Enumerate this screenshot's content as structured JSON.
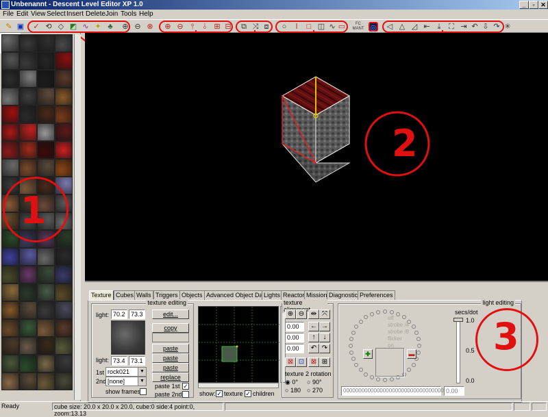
{
  "window": {
    "title": "Unbenannt - Descent Level Editor XP 1.0",
    "min_label": "_",
    "max_label": "▫",
    "close_label": "✕"
  },
  "menu": [
    "File",
    "Edit",
    "View",
    "Select",
    "Insert",
    "Delete",
    "Join",
    "Tools",
    "Help"
  ],
  "toolbar": {
    "groups": [
      "1",
      "2",
      "3",
      "4",
      "5"
    ],
    "button_label_small": "FC MANT"
  },
  "annotations": {
    "region_1": "1",
    "region_2": "2",
    "region_3": "3"
  },
  "colors": {
    "annotation_red": "#e01010",
    "viewport_bg": "#000000",
    "title_gradient_start": "#0a246a",
    "title_gradient_end": "#a6caf0"
  },
  "textures": {
    "colors": [
      "#6b6b6b",
      "#3b3b3b",
      "#2f2f2f",
      "#4a4a4a",
      "#555555",
      "#3a3a3a",
      "#262626",
      "#8a1010",
      "#2d2d2d",
      "#808080",
      "#1c1c1c",
      "#5a3a2a",
      "#777777",
      "#3f3f3f",
      "#5b4a3a",
      "#8b5a2b",
      "#a01010",
      "#2a2a2a",
      "#4a2a1a",
      "#7a3a1a",
      "#b01818",
      "#c02020",
      "#9a9a9a",
      "#5a1a1a",
      "#8a1a1a",
      "#a12a1a",
      "#3a0a0a",
      "#d02020",
      "#6a6a6a",
      "#7a4a2a",
      "#5a4a3a",
      "#8b4513",
      "#3a3a3a",
      "#7a5a3a",
      "#4a2a1a",
      "#7a7ab0",
      "#8a5a3a",
      "#4a3a2a",
      "#6a4a3a",
      "#5a5a5a",
      "#6b4b2b",
      "#4a4a4a",
      "#5a5a5a",
      "#6a6a6a",
      "#2a4a2a",
      "#3a3a5a",
      "#5a3a5a",
      "#2a3a2a",
      "#4040a0",
      "#5a5aa0",
      "#6a6a6a",
      "#2a2a2a",
      "#4a4a2a",
      "#6a3a6a",
      "#3a4a3a",
      "#3a3a6a",
      "#8a6a3a",
      "#2a3a2a",
      "#4a5a4a",
      "#5a4a2a",
      "#8a5a2a",
      "#5a4a3a",
      "#3a3a3a",
      "#4a4a5a",
      "#6a4a2a",
      "#3a5a3a",
      "#7a5a3a",
      "#5a3a2a",
      "#4a3a2a",
      "#6a5a4a",
      "#3a2a1a",
      "#5a5a3a",
      "#4a5a3a",
      "#2a4a2a",
      "#7a6a4a",
      "#3a3a3a",
      "#8a6a4a",
      "#5a4a3a",
      "#6a5a3a",
      "#4a4a3a"
    ]
  },
  "tabs": [
    "Texture",
    "Cubes",
    "Walls",
    "Triggers",
    "Objects",
    "Advanced Object Data",
    "Lights",
    "Reactor",
    "Mission",
    "Diagnostics",
    "Preferences"
  ],
  "texture_editing": {
    "legend": "texture editing",
    "light_label_top": "light:",
    "light_top_1": "70.2",
    "light_top_2": "73.3",
    "light_label_bottom": "light:",
    "light_bottom_1": "73.4",
    "light_bottom_2": "73.1",
    "edit_button": "edit...",
    "copy_button": "copy",
    "paste_button": "paste",
    "paste_marked_button": "paste marked",
    "paste_touching_button": "paste touching",
    "replace_button": "replace",
    "first_label": "1st",
    "first_value": "rock021",
    "second_label": "2nd",
    "second_value": "[none]",
    "show_frames_label": "show frames",
    "paste_1st_label": "paste 1st",
    "paste_2nd_label": "paste 2nd",
    "paste_1st_checked": "✓"
  },
  "preview": {
    "show_label": "show:",
    "texture_label": "texture",
    "children_label": "children",
    "texture_checked": "✓",
    "children_checked": "✓"
  },
  "texture_alignment": {
    "legend": "texture alignment",
    "value_1": "0.00",
    "value_2": "0.00",
    "value_3": "0.00",
    "rotation_label": "texture 2 rotation",
    "rot_0": "0°",
    "rot_90": "90°",
    "rot_180": "180",
    "rot_270": "270"
  },
  "light_editing": {
    "legend": "light editing",
    "secs_label": "secs/dot",
    "scale_top": "1.0",
    "scale_mid": "0.5",
    "scale_bottom": "0.0",
    "options": [
      "off",
      "strobe /4",
      "strobe /8",
      "flicker",
      "on"
    ],
    "pattern": "0000000000000000000000000000000000",
    "value": "0.00"
  },
  "status": {
    "ready": "Ready",
    "info": "cube size: 20.0 x 20.0 x 20.0, cube:0 side:4 point:0, zoom:13.13"
  }
}
